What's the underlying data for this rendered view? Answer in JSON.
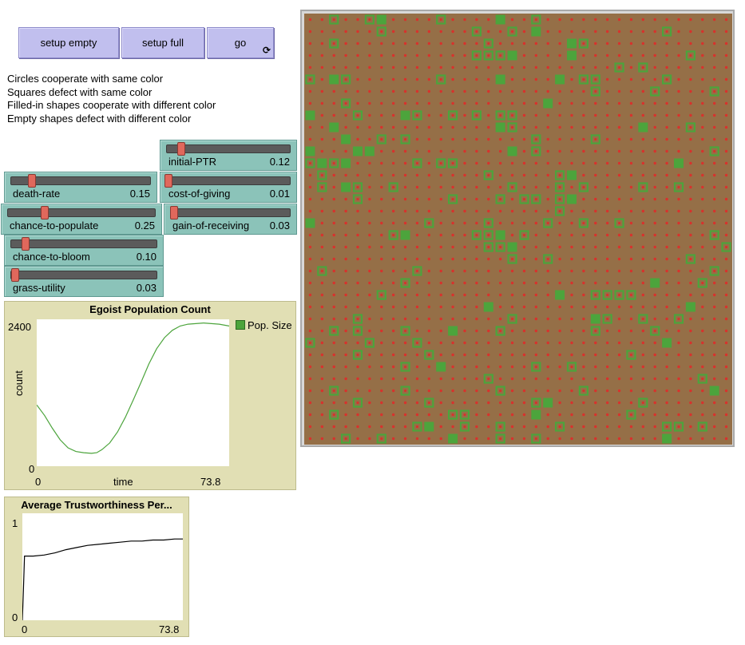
{
  "buttons": {
    "setup_empty": "setup empty",
    "setup_full": "setup full",
    "go": "go",
    "go_forever_icon": "cycle-arrows-icon"
  },
  "info_lines": [
    "Circles cooperate with same color",
    "Squares defect with same color",
    "Filled-in shapes cooperate with different color",
    "Empty shapes defect with different color"
  ],
  "sliders": {
    "initial_ptr": {
      "label": "initial-PTR",
      "value": "0.12",
      "fraction": 0.12
    },
    "death_rate": {
      "label": "death-rate",
      "value": "0.15",
      "fraction": 0.15
    },
    "cost_of_giving": {
      "label": "cost-of-giving",
      "value": "0.01",
      "fraction": 0.01
    },
    "chance_to_populate": {
      "label": "chance-to-populate",
      "value": "0.25",
      "fraction": 0.25
    },
    "gain_of_receiving": {
      "label": "gain-of-receiving",
      "value": "0.03",
      "fraction": 0.03
    },
    "chance_to_bloom": {
      "label": "chance-to-bloom",
      "value": "0.10",
      "fraction": 0.1
    },
    "grass_utility": {
      "label": "grass-utility",
      "value": "0.03",
      "fraction": 0.03
    }
  },
  "plot1": {
    "title": "Egoist Population Count",
    "xlabel": "time",
    "ylabel": "count",
    "xmin": "0",
    "xmax": "73.8",
    "ymin": "0",
    "ymax": "2400",
    "legend": "Pop. Size",
    "color": "#4ca43c"
  },
  "plot2": {
    "title": "Average Trustworthiness Per...",
    "xmin": "0",
    "xmax": "73.8",
    "ymin": "0",
    "ymax": "1",
    "color": "#000000"
  },
  "chart_data": [
    {
      "type": "line",
      "title": "Egoist Population Count",
      "xlabel": "time",
      "ylabel": "count",
      "xlim": [
        0,
        73.8
      ],
      "ylim": [
        0,
        2400
      ],
      "series": [
        {
          "name": "Pop. Size",
          "color": "#4ca43c",
          "x": [
            0,
            3,
            6,
            9,
            12,
            15,
            18,
            21,
            23,
            25,
            28,
            31,
            34,
            37,
            40,
            43,
            46,
            49,
            52,
            55,
            58,
            61,
            64,
            67,
            70,
            73.8
          ],
          "y": [
            1000,
            830,
            620,
            430,
            300,
            240,
            220,
            210,
            220,
            270,
            380,
            560,
            800,
            1080,
            1370,
            1670,
            1920,
            2100,
            2220,
            2290,
            2320,
            2330,
            2340,
            2330,
            2320,
            2290
          ]
        }
      ]
    },
    {
      "type": "line",
      "title": "Average Trustworthiness Per...",
      "xlim": [
        0,
        73.8
      ],
      "ylim": [
        0,
        1
      ],
      "series": [
        {
          "color": "#000000",
          "x": [
            0,
            0.5,
            1,
            5,
            10,
            15,
            20,
            25,
            30,
            35,
            40,
            45,
            50,
            55,
            60,
            65,
            70,
            73.8
          ],
          "y": [
            0,
            0.3,
            0.6,
            0.6,
            0.61,
            0.63,
            0.66,
            0.68,
            0.7,
            0.71,
            0.72,
            0.73,
            0.74,
            0.74,
            0.75,
            0.75,
            0.76,
            0.76
          ]
        }
      ]
    }
  ],
  "world": {
    "cols": 36,
    "rows": 36,
    "background": "#956f47",
    "dot_color": "#d8322d",
    "agent_color": "#4ca43c",
    "filled_cells": [
      [
        34,
        0
      ],
      [
        5,
        10
      ],
      [
        0,
        8
      ],
      [
        11,
        8
      ],
      [
        15,
        18
      ],
      [
        22,
        7
      ],
      [
        27,
        15
      ],
      [
        36,
        8
      ],
      [
        44,
        17
      ],
      [
        51,
        5
      ],
      [
        52,
        6
      ],
      [
        39,
        12
      ],
      [
        40,
        13
      ],
      [
        45,
        19
      ],
      [
        48,
        21
      ],
      [
        50,
        26
      ],
      [
        59,
        1
      ],
      [
        60,
        3
      ],
      [
        64,
        4
      ],
      [
        58,
        6
      ],
      [
        66,
        11
      ],
      [
        69,
        14
      ],
      [
        72,
        20
      ],
      [
        76,
        22
      ],
      [
        78,
        25
      ],
      [
        83,
        31
      ],
      [
        85,
        27
      ],
      [
        90,
        34
      ],
      [
        92,
        13
      ],
      [
        100,
        10
      ],
      [
        101,
        5
      ],
      [
        107,
        2
      ],
      [
        111,
        9
      ],
      [
        115,
        16
      ],
      [
        117,
        19
      ],
      [
        119,
        23
      ],
      [
        124,
        24
      ],
      [
        129,
        30
      ],
      [
        131,
        28
      ],
      [
        135,
        34
      ],
      [
        140,
        2
      ],
      [
        146,
        7
      ],
      [
        151,
        13
      ],
      [
        154,
        17
      ],
      [
        158,
        21
      ],
      [
        163,
        32
      ],
      [
        168,
        29
      ],
      [
        171,
        25
      ],
      [
        175,
        20
      ],
      [
        180,
        14
      ],
      [
        184,
        3
      ],
      [
        189,
        9
      ],
      [
        195,
        16
      ],
      [
        199,
        22
      ],
      [
        202,
        26
      ],
      [
        206,
        31
      ],
      [
        209,
        6
      ],
      [
        214,
        12
      ],
      [
        219,
        18
      ],
      [
        222,
        24
      ],
      [
        226,
        28
      ],
      [
        233,
        1
      ],
      [
        236,
        5
      ],
      [
        241,
        10
      ],
      [
        245,
        15
      ],
      [
        248,
        20
      ],
      [
        252,
        27
      ],
      [
        255,
        33
      ],
      [
        259,
        34
      ],
      [
        263,
        17
      ],
      [
        268,
        23
      ],
      [
        273,
        11
      ],
      [
        276,
        30
      ],
      [
        280,
        19
      ]
    ],
    "agents": []
  }
}
